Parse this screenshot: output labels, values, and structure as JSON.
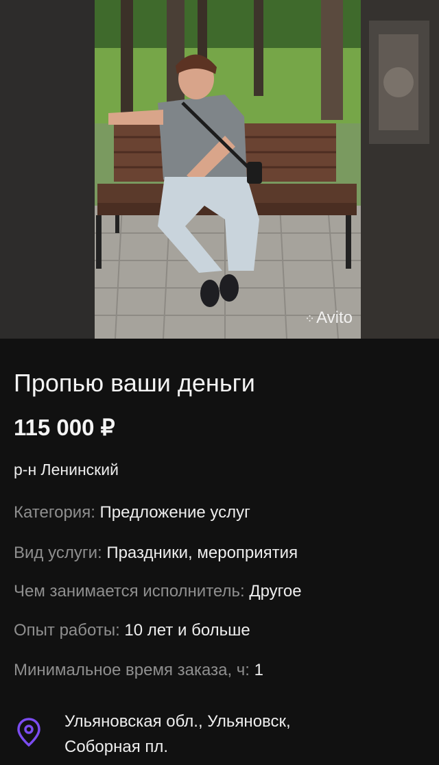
{
  "photo": {
    "watermark": "Avito"
  },
  "listing": {
    "title": "Пропью ваши деньги",
    "price": "115 000 ₽",
    "district": "р-н Ленинский"
  },
  "params": [
    {
      "label": "Категория: ",
      "value": "Предложение услуг"
    },
    {
      "label": "Вид услуги: ",
      "value": "Праздники, мероприятия"
    },
    {
      "label": "Чем занимается исполнитель: ",
      "value": "Другое"
    },
    {
      "label": "Опыт работы: ",
      "value": "10 лет и больше"
    },
    {
      "label": "Минимальное время заказа, ч: ",
      "value": "1"
    }
  ],
  "location": {
    "icon": "location-pin-icon",
    "line1": "Ульяновская обл., Ульяновск,",
    "line2": "Соборная пл."
  },
  "colors": {
    "background": "#111111",
    "accent": "#7b4cf0",
    "label": "#8f8f8f"
  }
}
